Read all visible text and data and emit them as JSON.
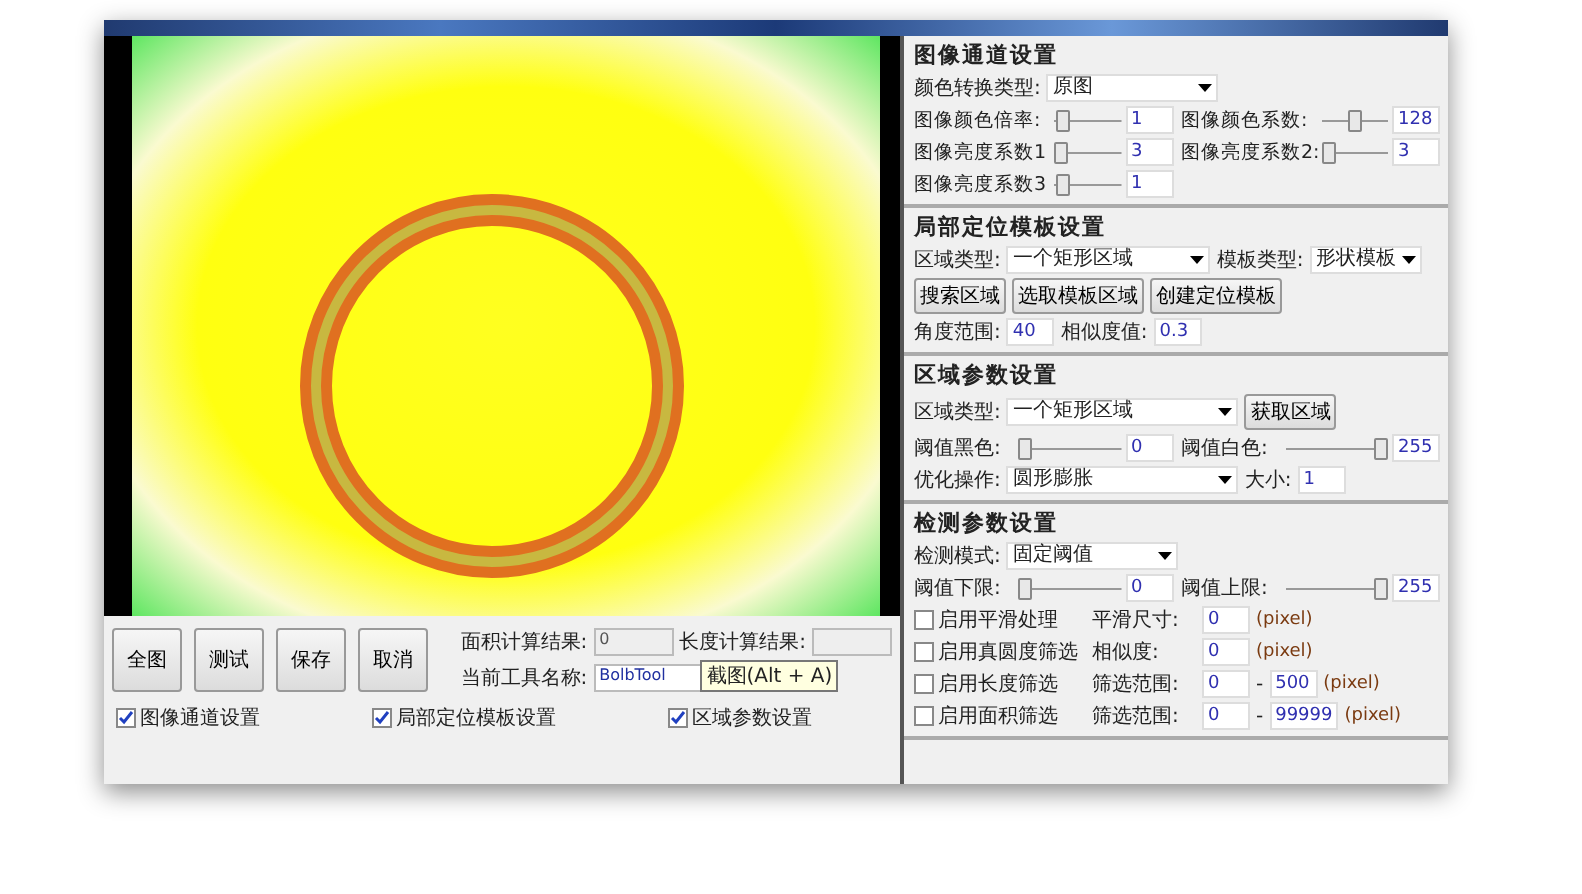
{
  "image_view": {
    "ring_visible": true
  },
  "bottom": {
    "buttons": [
      "全图",
      "测试",
      "保存",
      "取消"
    ],
    "area_result": {
      "label": "面积计算结果:",
      "value": "0"
    },
    "length_result": {
      "label": "长度计算结果:"
    },
    "tool_name": {
      "label": "当前工具名称:",
      "value": "BolbTool"
    },
    "tooltip": "截图(Alt + A)",
    "checkboxes": [
      {
        "label": "图像通道设置",
        "checked": true
      },
      {
        "label": "局部定位模板设置",
        "checked": true
      },
      {
        "label": "区域参数设置",
        "checked": true
      }
    ]
  },
  "channel": {
    "title": "图像通道设置",
    "mode": {
      "label": "颜色转换类型:",
      "value": "原图"
    },
    "sliders": [
      {
        "label": "图像颜色倍率:",
        "level": 0.05,
        "value": "1"
      },
      {
        "label": "图像颜色系数:",
        "level": 0.5,
        "value": "128"
      },
      {
        "label": "图像亮度系数1",
        "level": 0.0,
        "value": "3"
      },
      {
        "label": "图像亮度系数2:",
        "level": 0.0,
        "value": "3"
      },
      {
        "label": "图像亮度系数3",
        "level": 0.05,
        "value": "1"
      }
    ]
  },
  "template": {
    "title": "局部定位模板设置",
    "region": {
      "label": "区域类型:",
      "value": "一个矩形区域"
    },
    "template_type": {
      "label": "模板类型:",
      "value": "形状模板"
    },
    "buttons": [
      "搜索区域",
      "选取模板区域",
      "创建定位模板"
    ],
    "angle": {
      "label": "角度范围:",
      "value": "40"
    },
    "similarity": {
      "label": "相似度值:",
      "value": "0.3"
    }
  },
  "region": {
    "title": "区域参数设置",
    "region": {
      "label": "区域类型:",
      "value": "一个矩形区域"
    },
    "button": "获取区域",
    "sliders": [
      {
        "label": "阈值黑色:",
        "level": 0.0,
        "value": "0"
      },
      {
        "label": "阈值白色:",
        "level": 1.0,
        "value": "255"
      }
    ],
    "optimize": {
      "label": "优化操作:",
      "value": "圆形膨胀"
    },
    "size": {
      "label": "大小:",
      "value": "1"
    }
  },
  "detect": {
    "title": "检测参数设置",
    "mode": {
      "label": "检测模式:",
      "value": "固定阈值"
    },
    "sliders": [
      {
        "label": "阈值下限:",
        "level": 0.0,
        "value": "0"
      },
      {
        "label": "阈值上限:",
        "level": 1.0,
        "value": "255"
      }
    ],
    "filters": [
      {
        "label": "启用平滑处理",
        "checked": false,
        "param": "平滑尺寸:",
        "from": "0",
        "unit": "(pixel)"
      },
      {
        "label": "启用真圆度筛选",
        "checked": false,
        "param": "相似度:",
        "from": "0",
        "unit": "(pixel)"
      },
      {
        "label": "启用长度筛选",
        "checked": false,
        "param": "筛选范围:",
        "from": "0",
        "separator": "-",
        "to": "500",
        "unit": "(pixel)"
      },
      {
        "label": "启用面积筛选",
        "checked": false,
        "param": "筛选范围:",
        "from": "0",
        "separator": "-",
        "to": "99999",
        "unit": "(pixel)"
      }
    ]
  }
}
